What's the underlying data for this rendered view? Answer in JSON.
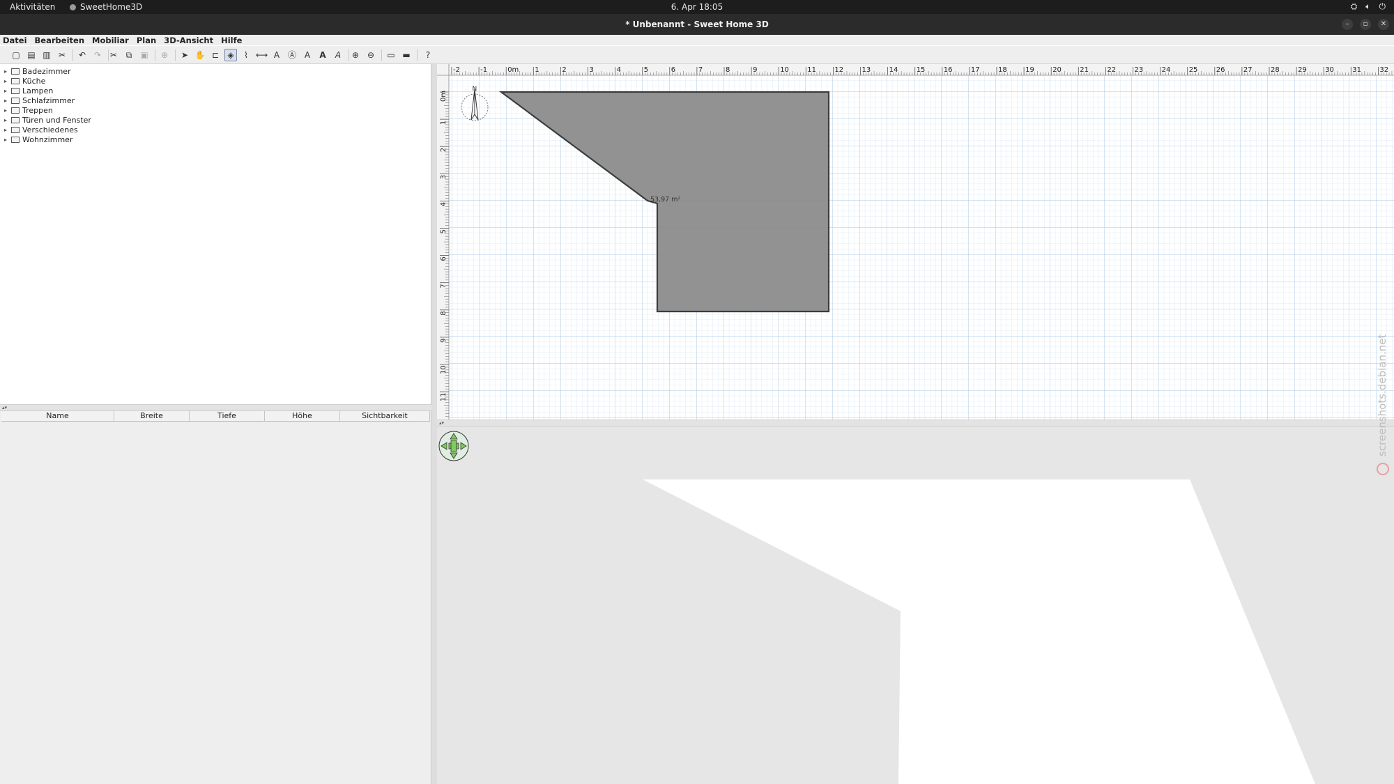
{
  "system_bar": {
    "activities": "Aktivitäten",
    "app_name": "SweetHome3D",
    "clock": "6. Apr  18:05"
  },
  "window": {
    "title": "* Unbenannt - Sweet Home 3D"
  },
  "menu": [
    "Datei",
    "Bearbeiten",
    "Mobiliar",
    "Plan",
    "3D-Ansicht",
    "Hilfe"
  ],
  "toolbar": {
    "icons": [
      "new-home-icon",
      "open-icon",
      "save-icon",
      "preferences-icon",
      "undo-icon",
      "redo-icon",
      "cut-icon",
      "copy-icon",
      "paste-icon",
      "add-furniture-icon",
      "select-mode-icon",
      "pan-mode-icon",
      "create-walls-icon",
      "create-rooms-icon",
      "create-polylines-icon",
      "create-dimensions-icon",
      "create-labels-icon",
      "text-style-icon",
      "increase-text-icon",
      "bold-text-icon",
      "italic-text-icon",
      "zoom-in-icon",
      "zoom-out-icon",
      "create-photo-icon",
      "create-video-icon",
      "help-icon"
    ],
    "selected": "create-rooms-icon"
  },
  "catalog": {
    "categories": [
      "Badezimmer",
      "Küche",
      "Lampen",
      "Schlafzimmer",
      "Treppen",
      "Türen und Fenster",
      "Verschiedenes",
      "Wohnzimmer"
    ]
  },
  "furniture_table": {
    "columns": [
      "Name",
      "Breite",
      "Tiefe",
      "Höhe",
      "Sichtbarkeit"
    ]
  },
  "plan": {
    "ruler_h": [
      "-2",
      "-1",
      "0m",
      "1",
      "2",
      "3",
      "4",
      "5",
      "6",
      "7",
      "8",
      "9",
      "10",
      "11",
      "12",
      "13",
      "14",
      "15",
      "16",
      "17",
      "18",
      "19",
      "20",
      "21",
      "22",
      "23",
      "24",
      "25",
      "26",
      "27",
      "28",
      "29",
      "30",
      "31",
      "32"
    ],
    "ruler_v": [
      "0m",
      "1",
      "2",
      "3",
      "4",
      "5",
      "6",
      "7",
      "8",
      "9",
      "10",
      "11"
    ],
    "compass_label": "N",
    "room_area": "53,97 m²",
    "room_color": "#8c8c8c"
  },
  "watermark": "screenshots.debian.net"
}
